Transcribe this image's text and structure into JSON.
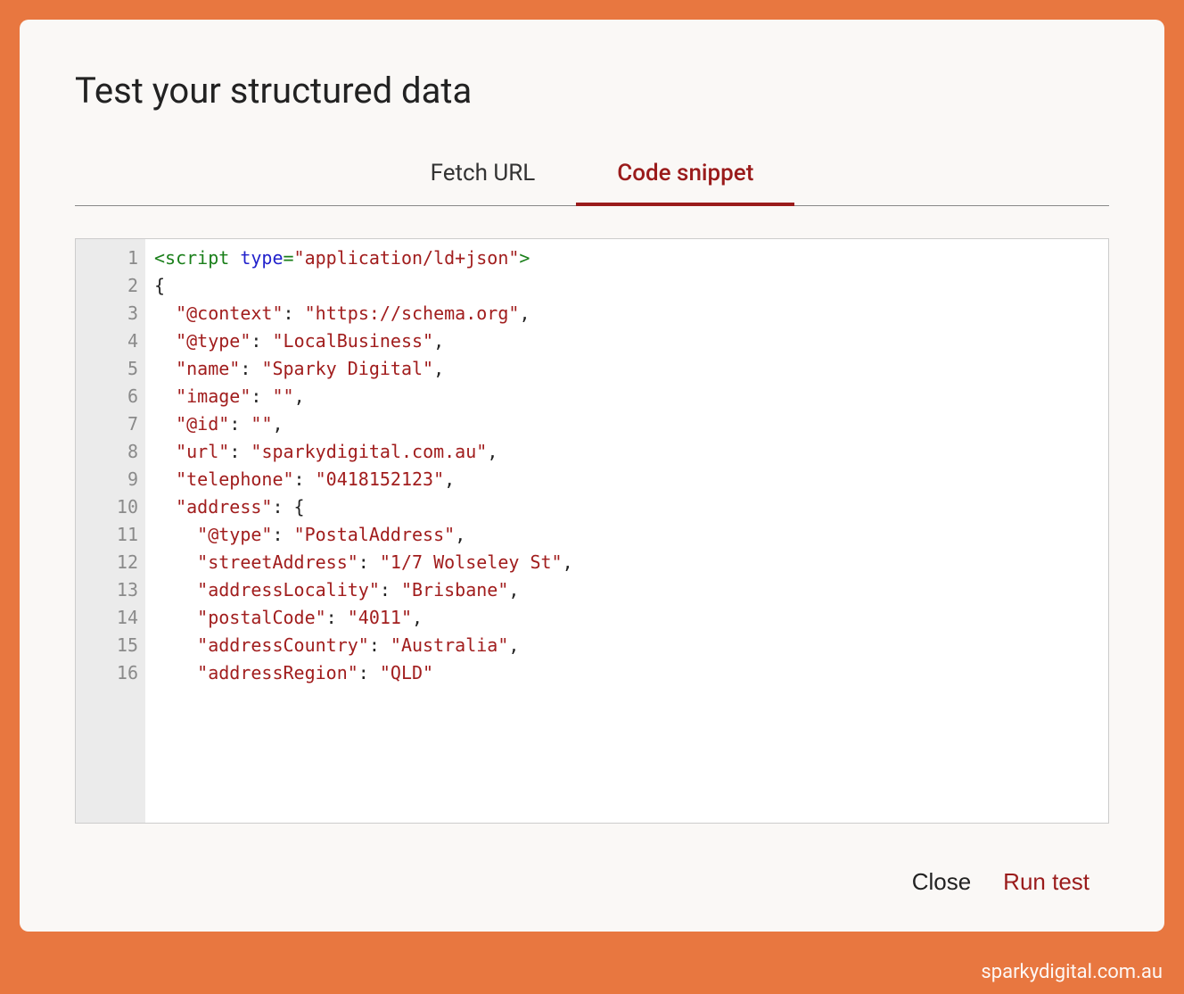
{
  "dialog": {
    "title": "Test your structured data"
  },
  "tabs": {
    "fetch_url": "Fetch URL",
    "code_snippet": "Code snippet"
  },
  "code_lines": [
    {
      "num": "1",
      "segments": [
        {
          "cls": "tag",
          "t": "<script "
        },
        {
          "cls": "attr",
          "t": "type"
        },
        {
          "cls": "tag",
          "t": "="
        },
        {
          "cls": "str",
          "t": "\"application/ld+json\""
        },
        {
          "cls": "tag",
          "t": ">"
        }
      ]
    },
    {
      "num": "2",
      "segments": [
        {
          "cls": "plain",
          "t": "{"
        }
      ]
    },
    {
      "num": "3",
      "segments": [
        {
          "cls": "plain",
          "t": "  "
        },
        {
          "cls": "str",
          "t": "\"@context\""
        },
        {
          "cls": "plain",
          "t": ": "
        },
        {
          "cls": "str",
          "t": "\"https://schema.org\""
        },
        {
          "cls": "plain",
          "t": ","
        }
      ]
    },
    {
      "num": "4",
      "segments": [
        {
          "cls": "plain",
          "t": "  "
        },
        {
          "cls": "str",
          "t": "\"@type\""
        },
        {
          "cls": "plain",
          "t": ": "
        },
        {
          "cls": "str",
          "t": "\"LocalBusiness\""
        },
        {
          "cls": "plain",
          "t": ","
        }
      ]
    },
    {
      "num": "5",
      "segments": [
        {
          "cls": "plain",
          "t": "  "
        },
        {
          "cls": "str",
          "t": "\"name\""
        },
        {
          "cls": "plain",
          "t": ": "
        },
        {
          "cls": "str",
          "t": "\"Sparky Digital\""
        },
        {
          "cls": "plain",
          "t": ","
        }
      ]
    },
    {
      "num": "6",
      "segments": [
        {
          "cls": "plain",
          "t": "  "
        },
        {
          "cls": "str",
          "t": "\"image\""
        },
        {
          "cls": "plain",
          "t": ": "
        },
        {
          "cls": "str",
          "t": "\"\""
        },
        {
          "cls": "plain",
          "t": ","
        }
      ]
    },
    {
      "num": "7",
      "segments": [
        {
          "cls": "plain",
          "t": "  "
        },
        {
          "cls": "str",
          "t": "\"@id\""
        },
        {
          "cls": "plain",
          "t": ": "
        },
        {
          "cls": "str",
          "t": "\"\""
        },
        {
          "cls": "plain",
          "t": ","
        }
      ]
    },
    {
      "num": "8",
      "segments": [
        {
          "cls": "plain",
          "t": "  "
        },
        {
          "cls": "str",
          "t": "\"url\""
        },
        {
          "cls": "plain",
          "t": ": "
        },
        {
          "cls": "str",
          "t": "\"sparkydigital.com.au\""
        },
        {
          "cls": "plain",
          "t": ","
        }
      ]
    },
    {
      "num": "9",
      "segments": [
        {
          "cls": "plain",
          "t": "  "
        },
        {
          "cls": "str",
          "t": "\"telephone\""
        },
        {
          "cls": "plain",
          "t": ": "
        },
        {
          "cls": "str",
          "t": "\"0418152123\""
        },
        {
          "cls": "plain",
          "t": ","
        }
      ]
    },
    {
      "num": "10",
      "segments": [
        {
          "cls": "plain",
          "t": "  "
        },
        {
          "cls": "str",
          "t": "\"address\""
        },
        {
          "cls": "plain",
          "t": ": {"
        }
      ]
    },
    {
      "num": "11",
      "segments": [
        {
          "cls": "plain",
          "t": "    "
        },
        {
          "cls": "str",
          "t": "\"@type\""
        },
        {
          "cls": "plain",
          "t": ": "
        },
        {
          "cls": "str",
          "t": "\"PostalAddress\""
        },
        {
          "cls": "plain",
          "t": ","
        }
      ]
    },
    {
      "num": "12",
      "segments": [
        {
          "cls": "plain",
          "t": "    "
        },
        {
          "cls": "str",
          "t": "\"streetAddress\""
        },
        {
          "cls": "plain",
          "t": ": "
        },
        {
          "cls": "str",
          "t": "\"1/7 Wolseley St\""
        },
        {
          "cls": "plain",
          "t": ","
        }
      ]
    },
    {
      "num": "13",
      "segments": [
        {
          "cls": "plain",
          "t": "    "
        },
        {
          "cls": "str",
          "t": "\"addressLocality\""
        },
        {
          "cls": "plain",
          "t": ": "
        },
        {
          "cls": "str",
          "t": "\"Brisbane\""
        },
        {
          "cls": "plain",
          "t": ","
        }
      ]
    },
    {
      "num": "14",
      "segments": [
        {
          "cls": "plain",
          "t": "    "
        },
        {
          "cls": "str",
          "t": "\"postalCode\""
        },
        {
          "cls": "plain",
          "t": ": "
        },
        {
          "cls": "str",
          "t": "\"4011\""
        },
        {
          "cls": "plain",
          "t": ","
        }
      ]
    },
    {
      "num": "15",
      "segments": [
        {
          "cls": "plain",
          "t": "    "
        },
        {
          "cls": "str",
          "t": "\"addressCountry\""
        },
        {
          "cls": "plain",
          "t": ": "
        },
        {
          "cls": "str",
          "t": "\"Australia\""
        },
        {
          "cls": "plain",
          "t": ","
        }
      ]
    },
    {
      "num": "16",
      "segments": [
        {
          "cls": "plain",
          "t": "    "
        },
        {
          "cls": "str",
          "t": "\"addressRegion\""
        },
        {
          "cls": "plain",
          "t": ": "
        },
        {
          "cls": "str",
          "t": "\"QLD\""
        }
      ]
    }
  ],
  "buttons": {
    "close": "Close",
    "run_test": "Run test"
  },
  "watermark": "sparkydigital.com.au"
}
